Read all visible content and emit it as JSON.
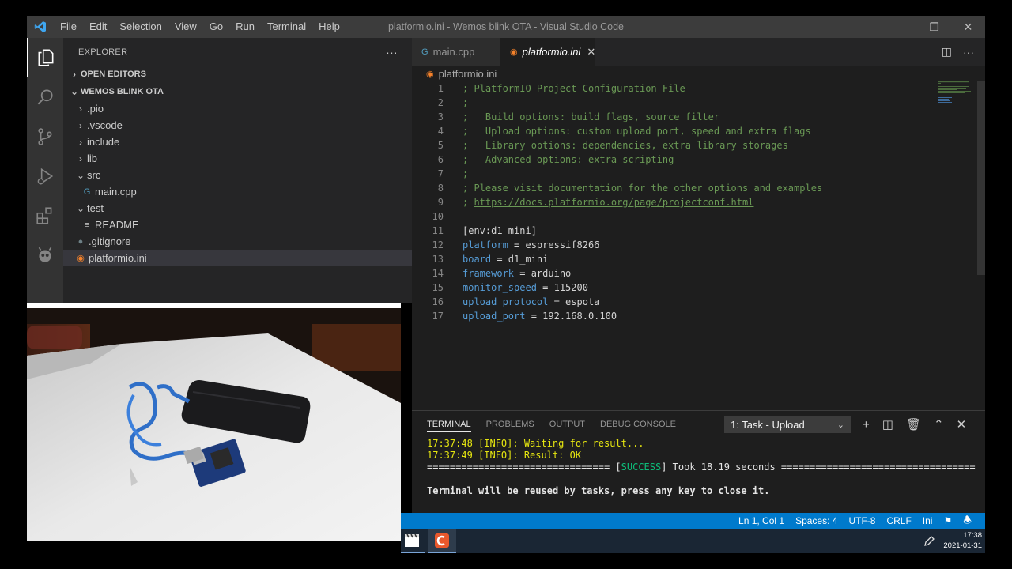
{
  "titlebar": {
    "menu": [
      "File",
      "Edit",
      "Selection",
      "View",
      "Go",
      "Run",
      "Terminal",
      "Help"
    ],
    "title": "platformio.ini - Wemos blink OTA - Visual Studio Code"
  },
  "sidebar": {
    "header": "EXPLORER",
    "open_editors": "OPEN EDITORS",
    "project": "WEMOS BLINK OTA",
    "tree": [
      {
        "label": ".pio"
      },
      {
        "label": ".vscode"
      },
      {
        "label": "include"
      },
      {
        "label": "lib"
      },
      {
        "label": "src"
      },
      {
        "label": "main.cpp"
      },
      {
        "label": "test"
      },
      {
        "label": "README"
      },
      {
        "label": ".gitignore"
      },
      {
        "label": "platformio.ini"
      }
    ]
  },
  "tabs": [
    {
      "label": "main.cpp"
    },
    {
      "label": "platformio.ini"
    }
  ],
  "breadcrumb": "platformio.ini",
  "code": {
    "lines": [
      {
        "n": "1",
        "text": "; PlatformIO Project Configuration File"
      },
      {
        "n": "2",
        "text": ";"
      },
      {
        "n": "3",
        "text": ";   Build options: build flags, source filter"
      },
      {
        "n": "4",
        "text": ";   Upload options: custom upload port, speed and extra flags"
      },
      {
        "n": "5",
        "text": ";   Library options: dependencies, extra library storages"
      },
      {
        "n": "6",
        "text": ";   Advanced options: extra scripting"
      },
      {
        "n": "7",
        "text": ";"
      },
      {
        "n": "8",
        "text": "; Please visit documentation for the other options and examples"
      },
      {
        "n": "9",
        "prefix": "; ",
        "link": "https://docs.platformio.org/page/projectconf.html"
      },
      {
        "n": "10",
        "text": ""
      },
      {
        "n": "11",
        "text": "[env:d1_mini]"
      },
      {
        "n": "12",
        "key": "platform",
        "value": " = espressif8266"
      },
      {
        "n": "13",
        "key": "board",
        "value": " = d1_mini"
      },
      {
        "n": "14",
        "key": "framework",
        "value": " = arduino"
      },
      {
        "n": "15",
        "key": "monitor_speed",
        "value": " = 115200"
      },
      {
        "n": "16",
        "key": "upload_protocol",
        "value": " = espota"
      },
      {
        "n": "17",
        "key": "upload_port",
        "value": " = 192.168.0.100"
      }
    ]
  },
  "panel": {
    "tabs": [
      "TERMINAL",
      "PROBLEMS",
      "OUTPUT",
      "DEBUG CONSOLE"
    ],
    "task_select": "1: Task - Upload",
    "terminal": {
      "line1": "17:37:48 [INFO]: Waiting for result...",
      "line2": "17:37:49 [INFO]: Result: OK",
      "line3_pre": "================================ [",
      "line3_success": "SUCCESS",
      "line3_post": "] Took 18.19 seconds ==================================",
      "line4": "",
      "line5": "Terminal will be reused by tasks, press any key to close it."
    }
  },
  "status": {
    "position": "Ln 1, Col 1",
    "spaces": "Spaces: 4",
    "encoding": "UTF-8",
    "eol": "CRLF",
    "language": "Ini"
  },
  "taskbar": {
    "time": "17:38",
    "date": "2021-01-31"
  },
  "colors": {
    "accent": "#007acc",
    "comment": "#6a9955",
    "key": "#569cd6"
  }
}
